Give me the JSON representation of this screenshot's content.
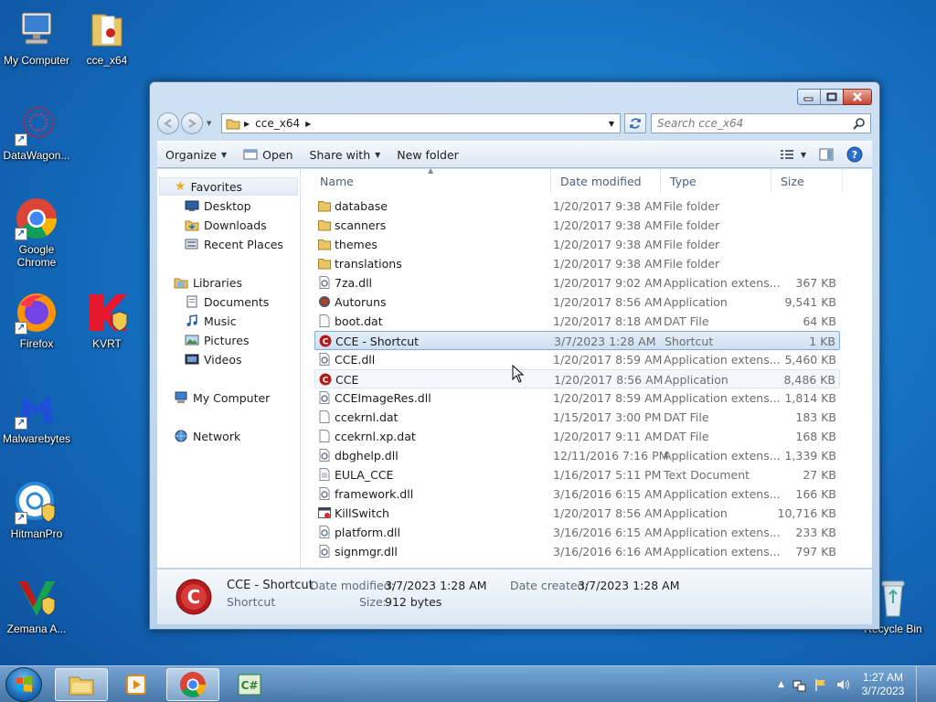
{
  "desktop": {
    "icons": [
      {
        "label": "My Computer"
      },
      {
        "label": "cce_x64"
      },
      {
        "label": "DataWagon..."
      },
      {
        "label": "Google Chrome"
      },
      {
        "label": "Firefox"
      },
      {
        "label": "KVRT"
      },
      {
        "label": "Malwarebytes"
      },
      {
        "label": "HitmanPro"
      },
      {
        "label": "Zemana A..."
      },
      {
        "label": "Recycle Bin"
      }
    ]
  },
  "window": {
    "address": {
      "folder": "cce_x64"
    },
    "search": {
      "placeholder": "Search cce_x64"
    },
    "toolbar": {
      "organize": "Organize",
      "open": "Open",
      "share_with": "Share with",
      "new_folder": "New folder"
    },
    "nav_pane": {
      "favorites": "Favorites",
      "favorites_items": [
        "Desktop",
        "Downloads",
        "Recent Places"
      ],
      "libraries": "Libraries",
      "libraries_items": [
        "Documents",
        "Music",
        "Pictures",
        "Videos"
      ],
      "computer": "My Computer",
      "network": "Network"
    },
    "columns": {
      "name": "Name",
      "date": "Date modified",
      "type": "Type",
      "size": "Size"
    },
    "files": [
      {
        "name": "database",
        "date": "1/20/2017 9:38 AM",
        "type": "File folder",
        "size": "",
        "icon": "folder-icon"
      },
      {
        "name": "scanners",
        "date": "1/20/2017 9:38 AM",
        "type": "File folder",
        "size": "",
        "icon": "folder-icon"
      },
      {
        "name": "themes",
        "date": "1/20/2017 9:38 AM",
        "type": "File folder",
        "size": "",
        "icon": "folder-icon"
      },
      {
        "name": "translations",
        "date": "1/20/2017 9:38 AM",
        "type": "File folder",
        "size": "",
        "icon": "folder-icon"
      },
      {
        "name": "7za.dll",
        "date": "1/20/2017 9:02 AM",
        "type": "Application extens...",
        "size": "367 KB",
        "icon": "dll-icon"
      },
      {
        "name": "Autoruns",
        "date": "1/20/2017 8:56 AM",
        "type": "Application",
        "size": "9,541 KB",
        "icon": "autoruns-icon"
      },
      {
        "name": "boot.dat",
        "date": "1/20/2017 8:18 AM",
        "type": "DAT File",
        "size": "64 KB",
        "icon": "file-icon"
      },
      {
        "name": "CCE - Shortcut",
        "date": "3/7/2023 1:28 AM",
        "type": "Shortcut",
        "size": "1 KB",
        "icon": "cce-icon"
      },
      {
        "name": "CCE.dll",
        "date": "1/20/2017 8:59 AM",
        "type": "Application extens...",
        "size": "5,460 KB",
        "icon": "dll-icon"
      },
      {
        "name": "CCE",
        "date": "1/20/2017 8:56 AM",
        "type": "Application",
        "size": "8,486 KB",
        "icon": "cce-icon"
      },
      {
        "name": "CCEImageRes.dll",
        "date": "1/20/2017 8:59 AM",
        "type": "Application extens...",
        "size": "1,814 KB",
        "icon": "dll-icon"
      },
      {
        "name": "ccekrnl.dat",
        "date": "1/15/2017 3:00 PM",
        "type": "DAT File",
        "size": "183 KB",
        "icon": "file-icon"
      },
      {
        "name": "ccekrnl.xp.dat",
        "date": "1/20/2017 9:11 AM",
        "type": "DAT File",
        "size": "168 KB",
        "icon": "file-icon"
      },
      {
        "name": "dbghelp.dll",
        "date": "12/11/2016 7:16 PM",
        "type": "Application extens...",
        "size": "1,339 KB",
        "icon": "dll-icon"
      },
      {
        "name": "EULA_CCE",
        "date": "1/16/2017 5:11 PM",
        "type": "Text Document",
        "size": "27 KB",
        "icon": "text-file-icon"
      },
      {
        "name": "framework.dll",
        "date": "3/16/2016 6:15 AM",
        "type": "Application extens...",
        "size": "166 KB",
        "icon": "dll-icon"
      },
      {
        "name": "KillSwitch",
        "date": "1/20/2017 8:56 AM",
        "type": "Application",
        "size": "10,716 KB",
        "icon": "killswitch-icon"
      },
      {
        "name": "platform.dll",
        "date": "3/16/2016 6:15 AM",
        "type": "Application extens...",
        "size": "233 KB",
        "icon": "dll-icon"
      },
      {
        "name": "signmgr.dll",
        "date": "3/16/2016 6:16 AM",
        "type": "Application extens...",
        "size": "797 KB",
        "icon": "dll-icon"
      }
    ],
    "selected_file": "CCE - Shortcut",
    "hovered_file": "CCE",
    "details": {
      "name": "CCE - Shortcut",
      "kind": "Shortcut",
      "modified_label": "Date modified:",
      "modified_value": "3/7/2023 1:28 AM",
      "created_label": "Date created:",
      "created_value": "3/7/2023 1:28 AM",
      "size_label": "Size:",
      "size_value": "912 bytes"
    }
  },
  "taskbar": {
    "clock_time": "1:27 AM",
    "clock_date": "3/7/2023",
    "pinned": [
      "start-orb",
      "explorer",
      "media-player",
      "chrome",
      "csharp-app"
    ]
  },
  "colors": {
    "selection_border": "#84acdd",
    "accent": "#1672c4"
  }
}
